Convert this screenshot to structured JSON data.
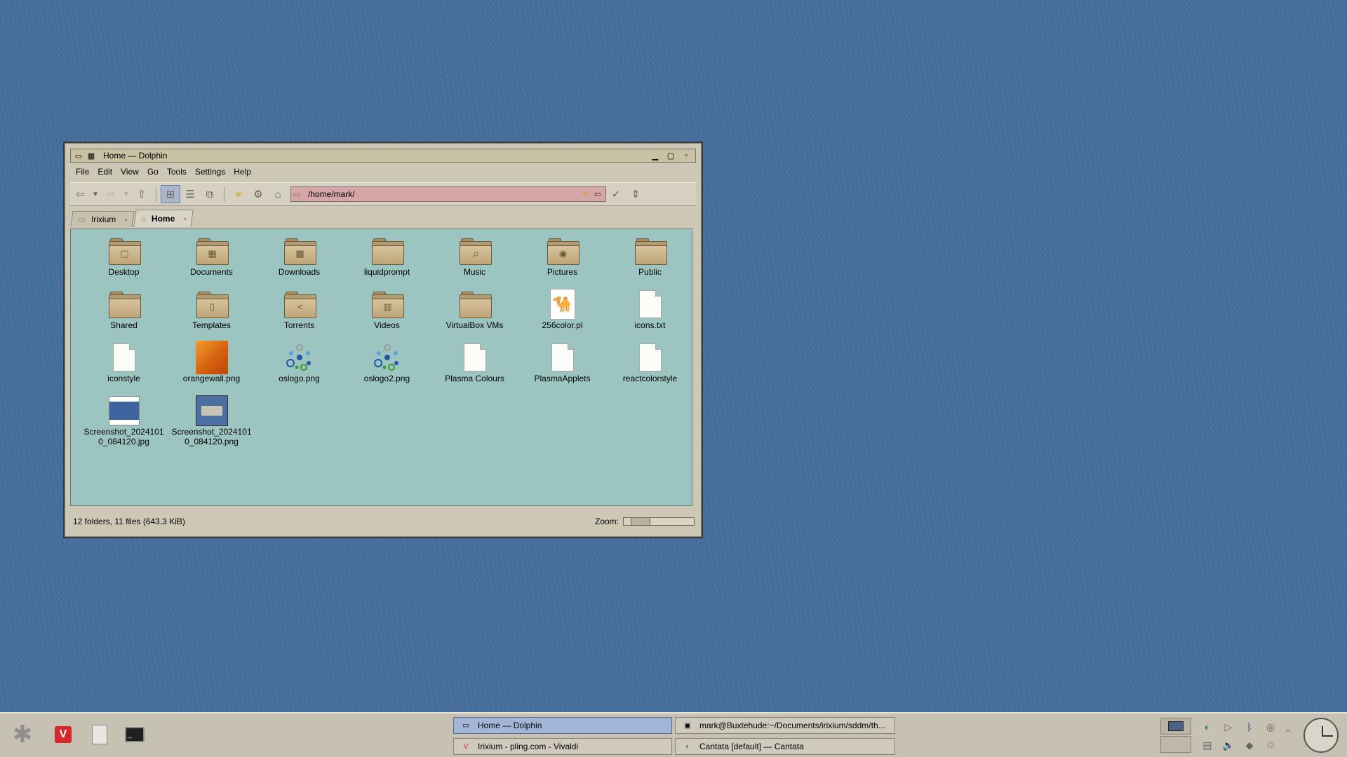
{
  "window": {
    "title": "Home — Dolphin",
    "menu": [
      "File",
      "Edit",
      "View",
      "Go",
      "Tools",
      "Settings",
      "Help"
    ],
    "location": "/home/mark/",
    "tabs": [
      {
        "label": "Irixium",
        "active": false
      },
      {
        "label": "Home",
        "active": true
      }
    ],
    "items": [
      {
        "name": "Desktop",
        "kind": "folder",
        "emblem": "▢"
      },
      {
        "name": "Documents",
        "kind": "folder",
        "emblem": "▦"
      },
      {
        "name": "Downloads",
        "kind": "folder",
        "emblem": "▩"
      },
      {
        "name": "liquidprompt",
        "kind": "folder",
        "emblem": ""
      },
      {
        "name": "Music",
        "kind": "folder",
        "emblem": "♫"
      },
      {
        "name": "Pictures",
        "kind": "folder",
        "emblem": "◉"
      },
      {
        "name": "Public",
        "kind": "folder",
        "emblem": ""
      },
      {
        "name": "Shared",
        "kind": "folder",
        "emblem": ""
      },
      {
        "name": "Templates",
        "kind": "folder",
        "emblem": "▯"
      },
      {
        "name": "Torrents",
        "kind": "folder",
        "emblem": "<"
      },
      {
        "name": "Videos",
        "kind": "folder",
        "emblem": "▥"
      },
      {
        "name": "VirtualBox VMs",
        "kind": "folder",
        "emblem": ""
      },
      {
        "name": "256color.pl",
        "kind": "camel",
        "emblem": "🐪"
      },
      {
        "name": "icons.txt",
        "kind": "doc",
        "emblem": ""
      },
      {
        "name": "iconstyle",
        "kind": "doc",
        "emblem": ""
      },
      {
        "name": "orangewall.png",
        "kind": "orange",
        "emblem": ""
      },
      {
        "name": "oslogo.png",
        "kind": "logo",
        "emblem": ""
      },
      {
        "name": "oslogo2.png",
        "kind": "logo",
        "emblem": ""
      },
      {
        "name": "Plasma Colours",
        "kind": "doc",
        "emblem": ""
      },
      {
        "name": "PlasmaApplets",
        "kind": "doc",
        "emblem": ""
      },
      {
        "name": "reactcolorstyle",
        "kind": "doc",
        "emblem": ""
      },
      {
        "name": "Screenshot_20241010_084120.jpg",
        "kind": "shot1",
        "emblem": ""
      },
      {
        "name": "Screenshot_20241010_084120.png",
        "kind": "shot2",
        "emblem": ""
      }
    ],
    "status": "12 folders, 11 files (643.3 KiB)",
    "zoom_label": "Zoom:"
  },
  "taskbar": {
    "tasks": [
      {
        "label": "Home — Dolphin",
        "active": true,
        "icon": "dolphin-icon"
      },
      {
        "label": "mark@Buxtehude:~/Documents/irixium/sddm/th...",
        "active": false,
        "icon": "terminal-icon"
      },
      {
        "label": "Irixium - pling.com - Vivaldi",
        "active": false,
        "icon": "vivaldi-icon"
      },
      {
        "label": "Cantata [default] — Cantata",
        "active": false,
        "icon": "cantata-icon"
      }
    ],
    "vivaldi_letter": "V",
    "terminal_prompt": "_"
  },
  "colors": {
    "desktop": "#47709e",
    "content_bg": "#9cc4c1",
    "location_bg": "#d6a5a8",
    "active_task": "#a3b6d8"
  }
}
